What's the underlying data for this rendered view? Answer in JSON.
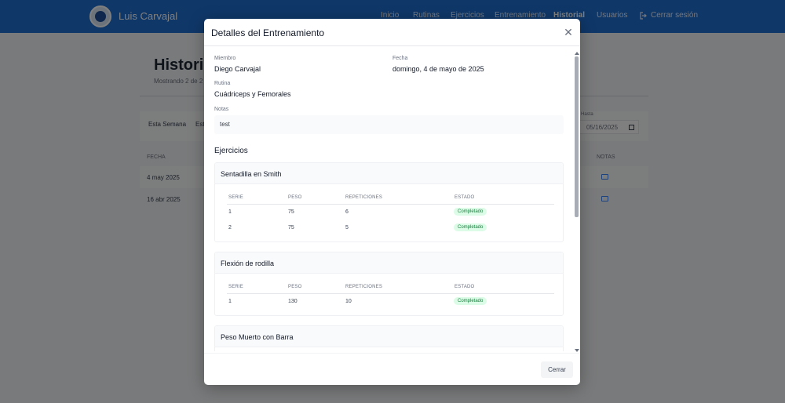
{
  "navbar": {
    "brand": "Luis Carvajal",
    "links": [
      "Inicio",
      "Rutinas",
      "Ejercicios",
      "Entrenamiento",
      "Historial",
      "Usuarios"
    ],
    "active": "Historial",
    "logout_label": "Cerrar sesión"
  },
  "background": {
    "title": "Historia",
    "subtitle": "Mostrando 2 de 2 e",
    "filters": [
      "Esta Semana",
      "Est"
    ],
    "date_label": "Hasta",
    "date_value": "05/16/2025",
    "table_headers": [
      "FECHA",
      "NOTAS"
    ],
    "rows": [
      {
        "fecha": "4 may 2025"
      },
      {
        "fecha": "16 abr 2025"
      }
    ]
  },
  "modal": {
    "title": "Detalles del Entrenamiento",
    "close_icon": "close-icon",
    "fields": {
      "member_label": "Miembro",
      "member_value": "Diego Carvajal",
      "date_label": "Fecha",
      "date_value": "domingo, 4 de mayo de 2025",
      "routine_label": "Rutina",
      "routine_value": "Cuádriceps y Femorales",
      "notes_label": "Notas",
      "notes_value": "test"
    },
    "exercises_title": "Ejercicios",
    "table_headers": [
      "SERIE",
      "PESO",
      "REPETICIONES",
      "ESTADO"
    ],
    "exercises": [
      {
        "name": "Sentadilla en Smith",
        "sets": [
          {
            "serie": "1",
            "peso": "75",
            "reps": "6",
            "estado": "Completado"
          },
          {
            "serie": "2",
            "peso": "75",
            "reps": "5",
            "estado": "Completado"
          }
        ]
      },
      {
        "name": "Flexión de rodilla",
        "sets": [
          {
            "serie": "1",
            "peso": "130",
            "reps": "10",
            "estado": "Completado"
          }
        ]
      },
      {
        "name": "Peso Muerto con Barra",
        "sets": []
      }
    ],
    "close_button": "Cerrar"
  },
  "colors": {
    "navbar": "#1e6fd1",
    "badge_bg": "#dcfce7",
    "badge_text": "#15803d",
    "note_icon": "#3b82f6"
  }
}
